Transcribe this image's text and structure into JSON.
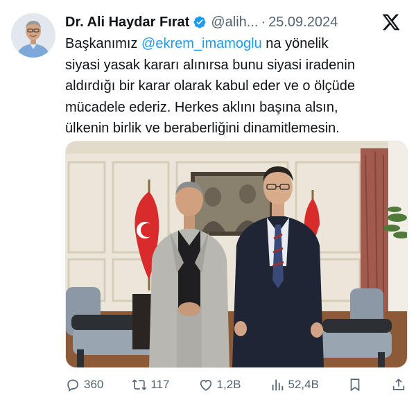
{
  "author": {
    "name": "Dr. Ali Haydar Fırat",
    "handle": "@alih...",
    "separator": "·",
    "date": "25.09.2024"
  },
  "tweet": {
    "prefix": "Başkanımız ",
    "mention": "@ekrem_imamoglu",
    "line1_suffix": " na yönelik",
    "line2": "siyasi yasak kararı alınırsa bunu siyasi iradenin",
    "line3": "aldırdığı bir karar olarak kabul eder ve o ölçüde",
    "line4": "mücadele ederiz. Herkes aklını başına alsın,",
    "line5": "ülkenin birlik ve beraberliğini dinamitlemesin."
  },
  "actions": {
    "replies": "360",
    "reposts": "117",
    "likes": "1,2B",
    "views": "52,4B"
  },
  "colors": {
    "mention": "#1d9bf0",
    "verified": "#1d9bf0",
    "muted_text": "#536471",
    "text": "#0f1419"
  },
  "icons": [
    "verified-badge-icon",
    "x-logo-icon",
    "reply-icon",
    "repost-icon",
    "like-icon",
    "views-icon",
    "bookmark-icon",
    "share-icon"
  ]
}
